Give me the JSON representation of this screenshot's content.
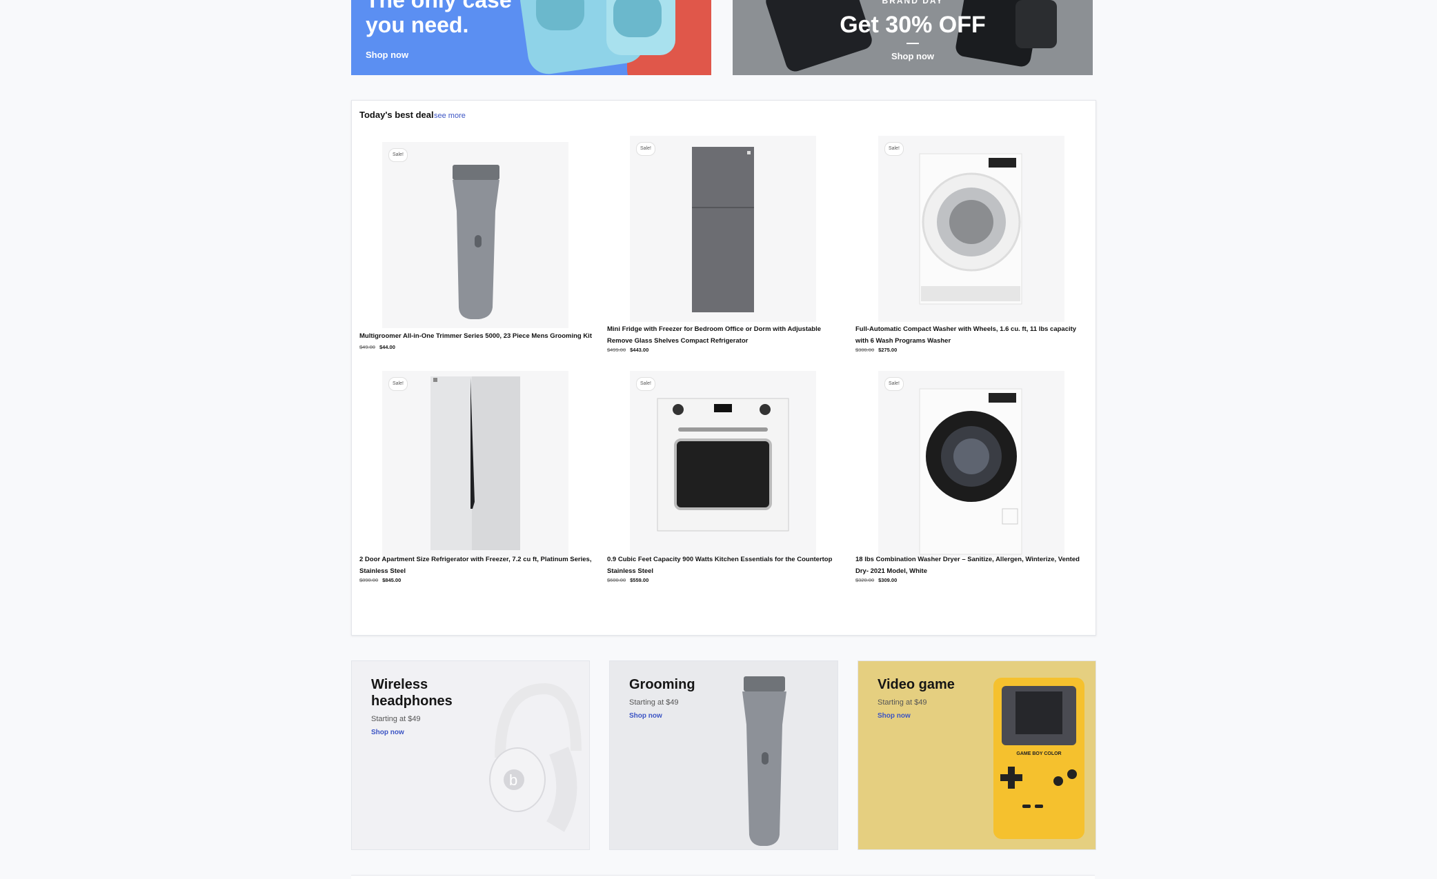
{
  "banners": {
    "left": {
      "title": "The only case you need.",
      "shop_label": "Shop now"
    },
    "right": {
      "eyebrow": "BRAND DAY",
      "headline": "Get 30% OFF",
      "shop_label": "Shop now"
    }
  },
  "deals": {
    "heading": "Today's best deal",
    "see_more": "see more",
    "products": [
      {
        "name": "Multigroomer All-in-One Trimmer Series 5000, 23 Piece Mens Grooming Kit",
        "old_price": "$49.00",
        "price": "$44.00",
        "badge": "Sale!",
        "icon": "trimmer-image"
      },
      {
        "name": "Mini Fridge with Freezer for Bedroom Office or Dorm with Adjustable Remove Glass Shelves Compact Refrigerator",
        "old_price": "$499.00",
        "price": "$443.00",
        "badge": "Sale!",
        "icon": "fridge-image"
      },
      {
        "name": "Full-Automatic Compact Washer with Wheels, 1.6 cu. ft, 11 lbs capacity with 6 Wash Programs Washer",
        "old_price": "$300.00",
        "price": "$275.00",
        "badge": "Sale!",
        "icon": "washer-image"
      },
      {
        "name": "2 Door Apartment Size Refrigerator with Freezer, 7.2 cu ft, Platinum Series, Stainless Steel",
        "old_price": "$890.00",
        "price": "$845.00",
        "badge": "Sale!",
        "icon": "refrigerator-image"
      },
      {
        "name": "0.9 Cubic Feet Capacity 900 Watts Kitchen Essentials for the Countertop Stainless Steel",
        "old_price": "$600.00",
        "price": "$559.00",
        "badge": "Sale!",
        "icon": "oven-image"
      },
      {
        "name": "18 lbs Combination Washer Dryer – Sanitize, Allergen, Winterize, Vented Dry- 2021 Model, White",
        "old_price": "$320.00",
        "price": "$309.00",
        "badge": "Sale!",
        "icon": "washer-dryer-image"
      }
    ]
  },
  "categories": [
    {
      "title": "Wireless headphones",
      "subtitle": "Starting at $49",
      "shop_label": "Shop now",
      "bg": "#f1f1f4"
    },
    {
      "title": "Grooming",
      "subtitle": "Starting at $49",
      "shop_label": "Shop now",
      "bg": "#e9eaed"
    },
    {
      "title": "Video game",
      "subtitle": "Starting at $49",
      "shop_label": "Shop now",
      "bg": "#e5cf80"
    }
  ],
  "gameboy_label": "GAME BOY COLOR",
  "colors": {
    "link": "#3b54c4",
    "gameboy": "#f5c12e"
  }
}
